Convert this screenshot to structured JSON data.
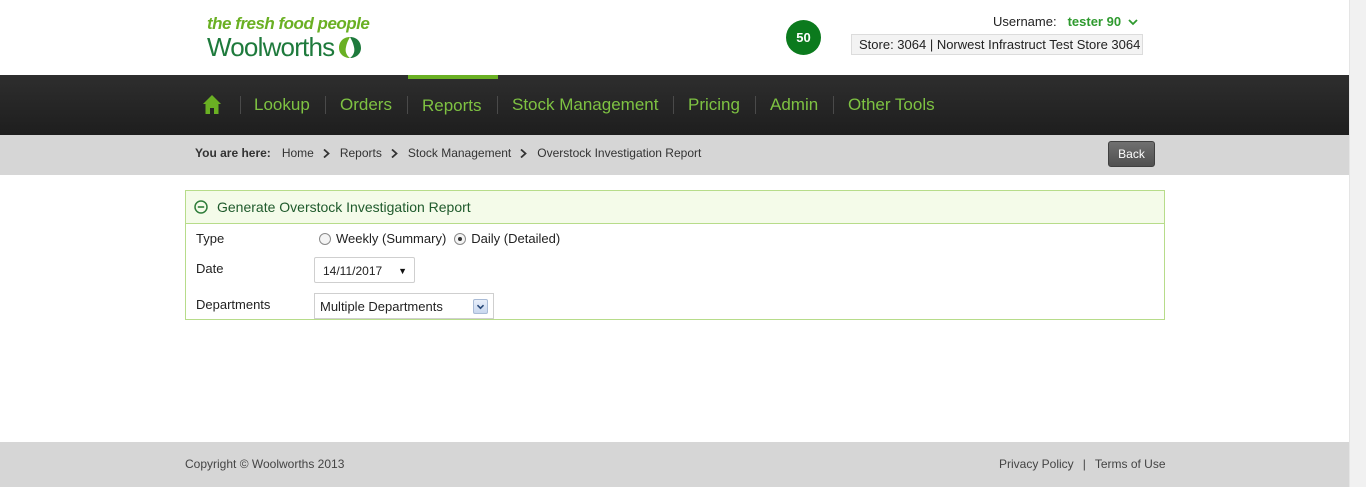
{
  "header": {
    "tagline": "the fresh food people",
    "brand": "Woolworths",
    "badge_count": "50",
    "username_label": "Username:",
    "username": "tester 90",
    "store": "Store: 3064 | Norwest Infrastruct Test Store 3064"
  },
  "nav": {
    "items": [
      {
        "label": "Lookup"
      },
      {
        "label": "Orders"
      },
      {
        "label": "Reports"
      },
      {
        "label": "Stock Management"
      },
      {
        "label": "Pricing"
      },
      {
        "label": "Admin"
      },
      {
        "label": "Other Tools"
      }
    ],
    "active": "Reports"
  },
  "breadcrumb": {
    "prefix": "You are here:",
    "items": [
      "Home",
      "Reports",
      "Stock Management",
      "Overstock Investigation Report"
    ],
    "back_label": "Back"
  },
  "panel": {
    "title": "Generate Overstock Investigation Report",
    "type_label": "Type",
    "type_options": [
      {
        "label": "Weekly (Summary)",
        "checked": false
      },
      {
        "label": "Daily (Detailed)",
        "checked": true
      }
    ],
    "date_label": "Date",
    "date_value": "14/11/2017",
    "departments_label": "Departments",
    "departments_value": "Multiple Departments"
  },
  "footer": {
    "copyright": "Copyright © Woolworths 2013",
    "privacy": "Privacy Policy",
    "separator": "|",
    "terms": "Terms of Use"
  },
  "colors": {
    "brand_green": "#1e7a3c",
    "accent_green": "#7ec242",
    "badge_green": "#0b7a1d",
    "nav_bg": "#262626"
  }
}
